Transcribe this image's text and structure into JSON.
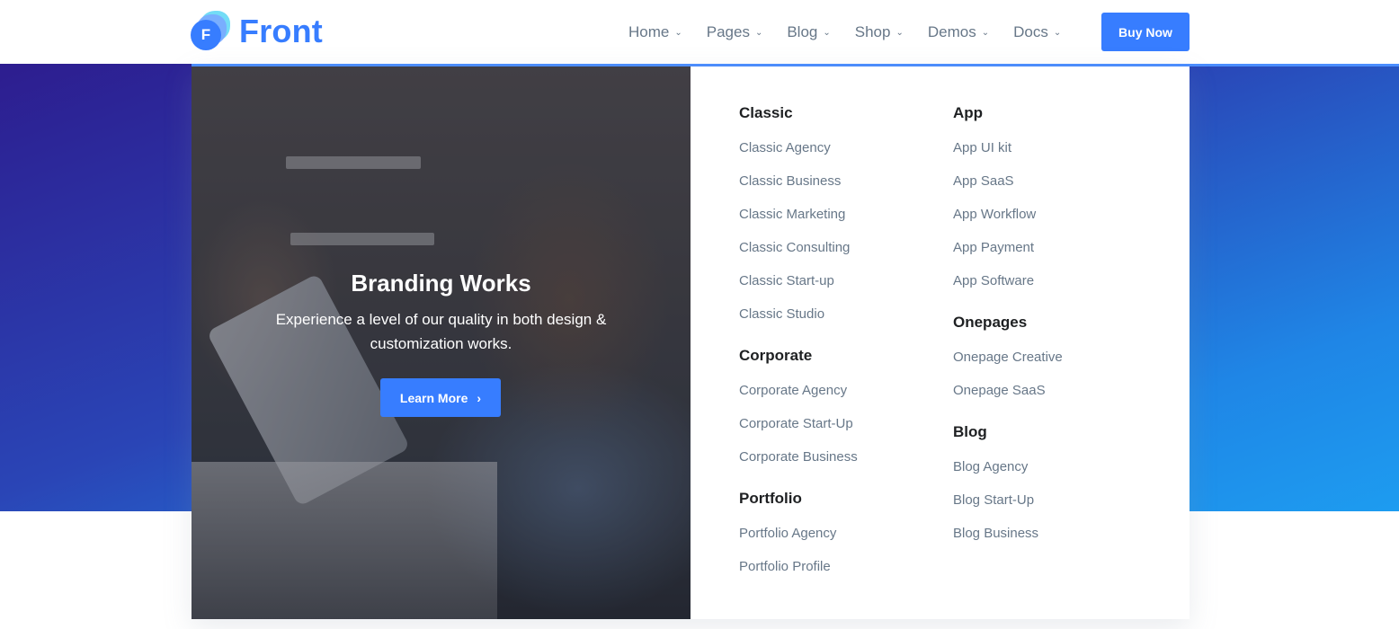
{
  "brand": {
    "logo_letter": "F",
    "name": "Front"
  },
  "nav": {
    "items": [
      {
        "label": "Home"
      },
      {
        "label": "Pages"
      },
      {
        "label": "Blog"
      },
      {
        "label": "Shop"
      },
      {
        "label": "Demos"
      },
      {
        "label": "Docs"
      }
    ],
    "cta_label": "Buy Now"
  },
  "mega_menu": {
    "promo": {
      "title": "Branding Works",
      "text": "Experience a level of our quality in both design & customization works.",
      "button_label": "Learn More"
    },
    "groups": [
      {
        "heading": "Classic",
        "links": [
          "Classic Agency",
          "Classic Business",
          "Classic Marketing",
          "Classic Consulting",
          "Classic Start-up",
          "Classic Studio"
        ]
      },
      {
        "heading": "Corporate",
        "links": [
          "Corporate Agency",
          "Corporate Start-Up",
          "Corporate Business"
        ]
      },
      {
        "heading": "Portfolio",
        "links": [
          "Portfolio Agency",
          "Portfolio Profile"
        ]
      },
      {
        "heading": "App",
        "links": [
          "App UI kit",
          "App SaaS",
          "App Workflow",
          "App Payment",
          "App Software"
        ]
      },
      {
        "heading": "Onepages",
        "links": [
          "Onepage Creative",
          "Onepage SaaS"
        ]
      },
      {
        "heading": "Blog",
        "links": [
          "Blog Agency",
          "Blog Start-Up",
          "Blog Business"
        ]
      }
    ]
  },
  "colors": {
    "primary": "#377dff",
    "heading": "#1e2022",
    "muted": "#677788"
  }
}
